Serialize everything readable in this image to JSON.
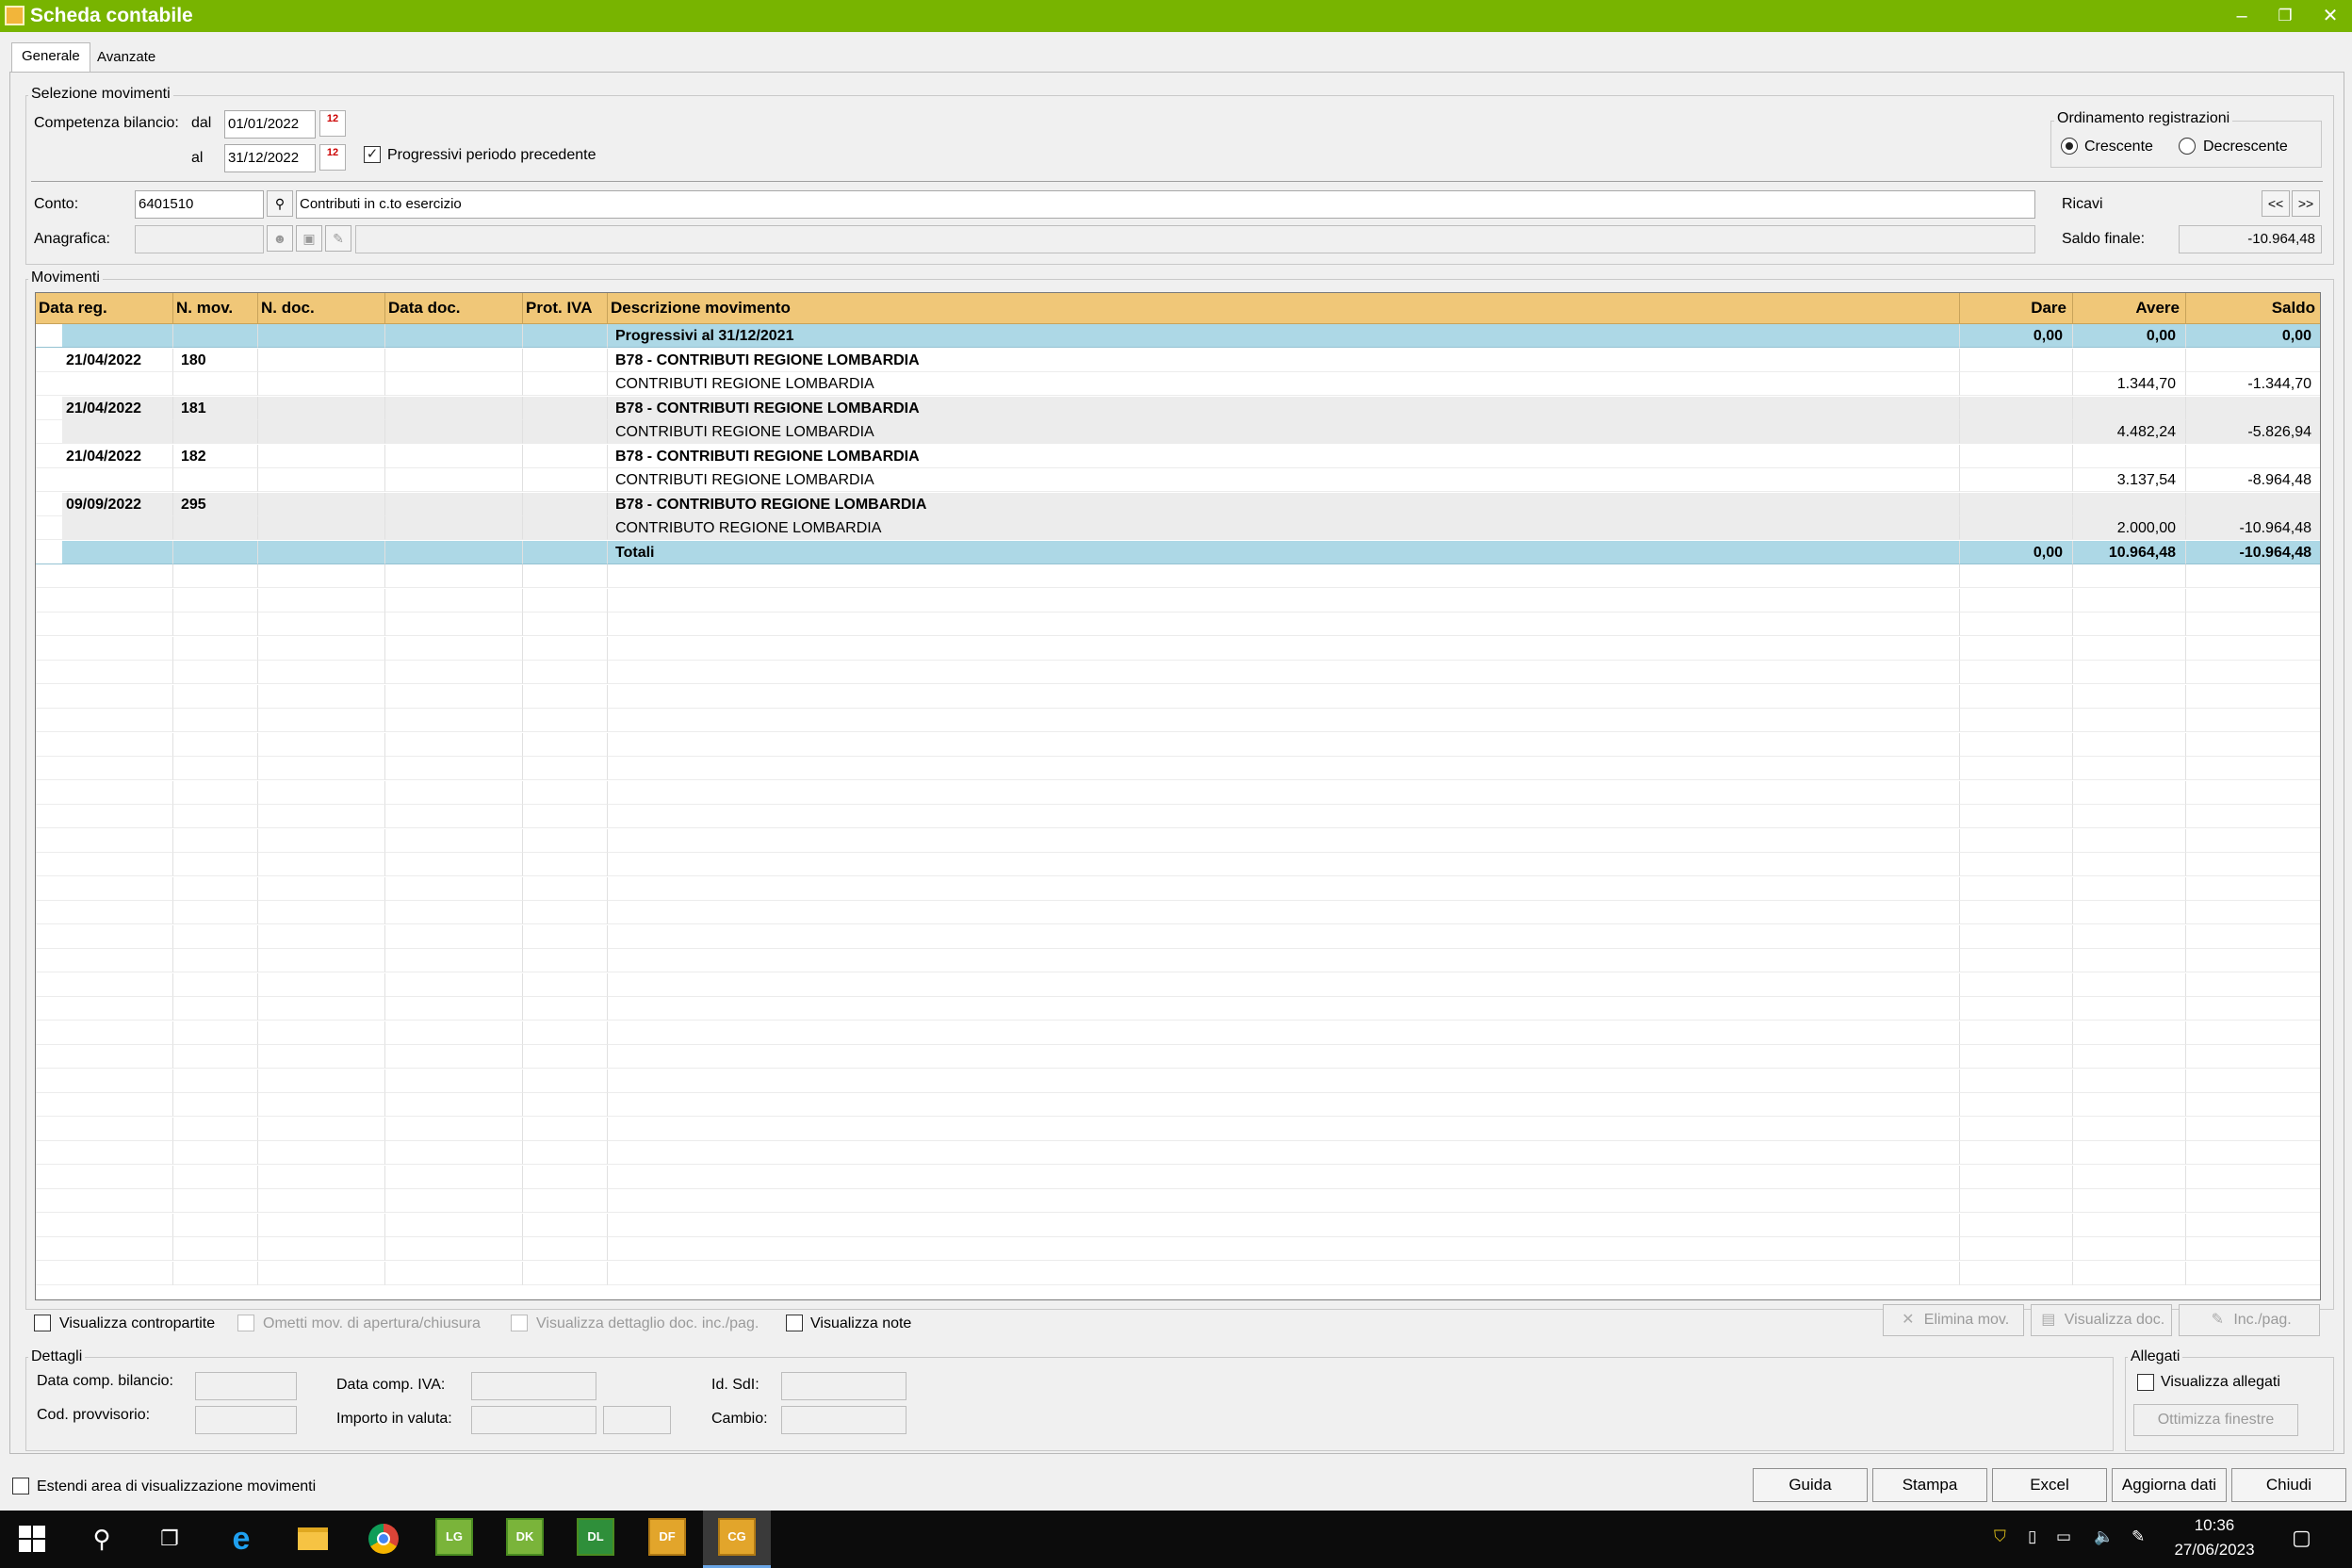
{
  "window": {
    "title": "Scheda contabile",
    "minimize": "–",
    "restore": "❐",
    "close": "✕",
    "app_icon": "spreadsheet-icon"
  },
  "tabs": [
    {
      "label": "Generale",
      "active": true
    },
    {
      "label": "Avanzate",
      "active": false
    }
  ],
  "selezione": {
    "title": "Selezione movimenti",
    "competenza_label": "Competenza bilancio:",
    "dal_label": "dal",
    "dal_value": "01/01/2022",
    "al_label": "al",
    "al_value": "31/12/2022",
    "progressivi_label": "Progressivi periodo precedente",
    "progressivi_checked": true,
    "cal_icon": "12"
  },
  "ordinamento": {
    "title": "Ordinamento registrazioni",
    "crescente": "Crescente",
    "decrescente": "Decrescente",
    "selected": "Crescente"
  },
  "conto": {
    "label": "Conto:",
    "code": "6401510",
    "description": "Contributi in c.to esercizio",
    "type": "Ricavi",
    "prev": "<<",
    "next": ">>"
  },
  "anagrafica": {
    "label": "Anagrafica:",
    "code": "",
    "description": ""
  },
  "saldo": {
    "label": "Saldo finale:",
    "value": "-10.964,48"
  },
  "movimenti": {
    "title": "Movimenti",
    "columns": [
      "Data reg.",
      "N. mov.",
      "N. doc.",
      "Data doc.",
      "Prot. IVA",
      "Descrizione movimento",
      "Dare",
      "Avere",
      "Saldo"
    ],
    "rows": [
      {
        "type": "highlight",
        "bold": true,
        "data_reg": "",
        "n_mov": "",
        "n_doc": "",
        "data_doc": "",
        "prot_iva": "",
        "descrizione": "Progressivi al 31/12/2021",
        "dare": "0,00",
        "avere": "0,00",
        "saldo": "0,00"
      },
      {
        "type": "alt",
        "bold": true,
        "data_reg": "21/04/2022",
        "n_mov": "180",
        "n_doc": "",
        "data_doc": "",
        "prot_iva": "",
        "descrizione": "B78 - CONTRIBUTI REGIONE LOMBARDIA",
        "dare": "",
        "avere": "",
        "saldo": ""
      },
      {
        "type": "alt",
        "bold": false,
        "data_reg": "",
        "n_mov": "",
        "n_doc": "",
        "data_doc": "",
        "prot_iva": "",
        "descrizione": "CONTRIBUTI REGIONE LOMBARDIA",
        "dare": "",
        "avere": "1.344,70",
        "saldo": "-1.344,70"
      },
      {
        "type": "alt2",
        "bold": true,
        "data_reg": "21/04/2022",
        "n_mov": "181",
        "n_doc": "",
        "data_doc": "",
        "prot_iva": "",
        "descrizione": "B78 - CONTRIBUTI REGIONE LOMBARDIA",
        "dare": "",
        "avere": "",
        "saldo": ""
      },
      {
        "type": "alt2",
        "bold": false,
        "data_reg": "",
        "n_mov": "",
        "n_doc": "",
        "data_doc": "",
        "prot_iva": "",
        "descrizione": "CONTRIBUTI REGIONE LOMBARDIA",
        "dare": "",
        "avere": "4.482,24",
        "saldo": "-5.826,94"
      },
      {
        "type": "alt",
        "bold": true,
        "data_reg": "21/04/2022",
        "n_mov": "182",
        "n_doc": "",
        "data_doc": "",
        "prot_iva": "",
        "descrizione": "B78 - CONTRIBUTI REGIONE LOMBARDIA",
        "dare": "",
        "avere": "",
        "saldo": ""
      },
      {
        "type": "alt",
        "bold": false,
        "data_reg": "",
        "n_mov": "",
        "n_doc": "",
        "data_doc": "",
        "prot_iva": "",
        "descrizione": "CONTRIBUTI REGIONE LOMBARDIA",
        "dare": "",
        "avere": "3.137,54",
        "saldo": "-8.964,48"
      },
      {
        "type": "alt2",
        "bold": true,
        "data_reg": "09/09/2022",
        "n_mov": "295",
        "n_doc": "",
        "data_doc": "",
        "prot_iva": "",
        "descrizione": "B78 - CONTRIBUTO REGIONE LOMBARDIA",
        "dare": "",
        "avere": "",
        "saldo": ""
      },
      {
        "type": "alt2",
        "bold": false,
        "data_reg": "",
        "n_mov": "",
        "n_doc": "",
        "data_doc": "",
        "prot_iva": "",
        "descrizione": "CONTRIBUTO REGIONE LOMBARDIA",
        "dare": "",
        "avere": "2.000,00",
        "saldo": "-10.964,48"
      },
      {
        "type": "highlight",
        "bold": true,
        "data_reg": "",
        "n_mov": "",
        "n_doc": "",
        "data_doc": "",
        "prot_iva": "",
        "descrizione": "Totali",
        "dare": "0,00",
        "avere": "10.964,48",
        "saldo": "-10.964,48"
      }
    ]
  },
  "options": {
    "contropartite": "Visualizza contropartite",
    "ometti": "Ometti mov. di apertura/chiusura",
    "dettaglio": "Visualizza dettaglio doc. inc./pag.",
    "note": "Visualizza note"
  },
  "actions": {
    "elimina": "Elimina mov.",
    "visualizza_doc": "Visualizza doc.",
    "inc_pag": "Inc./pag."
  },
  "dettagli": {
    "title": "Dettagli",
    "data_comp_bilancio": "Data comp. bilancio:",
    "cod_provvisorio": "Cod. provvisorio:",
    "data_comp_iva": "Data comp. IVA:",
    "importo_valuta": "Importo in valuta:",
    "id_sdi": "Id. SdI:",
    "cambio": "Cambio:"
  },
  "allegati": {
    "title": "Allegati",
    "visualizza": "Visualizza allegati",
    "ottimizza": "Ottimizza finestre"
  },
  "footer": {
    "estendi": "Estendi area di visualizzazione movimenti",
    "guida": "Guida",
    "stampa": "Stampa",
    "excel": "Excel",
    "aggiorna": "Aggiorna dati",
    "chiudi": "Chiudi"
  },
  "taskbar": {
    "apps": [
      "LG",
      "DK",
      "DL",
      "DF",
      "CG"
    ],
    "time": "10:36",
    "date": "27/06/2023",
    "icons": [
      "windows-start-icon",
      "search-icon",
      "task-view-icon",
      "edge-icon",
      "file-explorer-icon",
      "chrome-icon"
    ]
  }
}
